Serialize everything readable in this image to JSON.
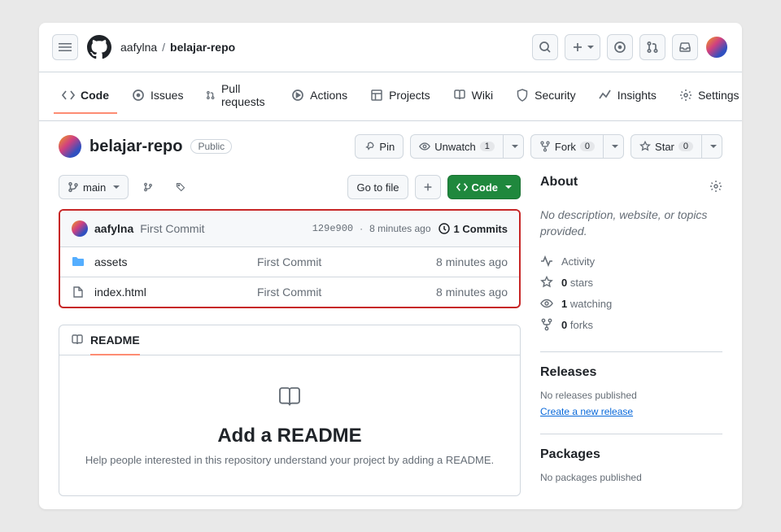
{
  "breadcrumb": {
    "owner": "aafylna",
    "repo": "belajar-repo",
    "sep": "/"
  },
  "nav": {
    "code": "Code",
    "issues": "Issues",
    "pulls": "Pull requests",
    "actions": "Actions",
    "projects": "Projects",
    "wiki": "Wiki",
    "security": "Security",
    "insights": "Insights",
    "settings": "Settings"
  },
  "repoHeader": {
    "title": "belajar-repo",
    "visibility": "Public",
    "pin": "Pin",
    "unwatch": "Unwatch",
    "unwatchCount": "1",
    "fork": "Fork",
    "forkCount": "0",
    "star": "Star",
    "starCount": "0"
  },
  "tools": {
    "branch": "main",
    "gotofile": "Go to file",
    "code": "Code"
  },
  "commit": {
    "author": "aafylna",
    "message": "First Commit",
    "sha": "129e900",
    "sep": "·",
    "time": "8 minutes ago",
    "countLabel": "1 Commits"
  },
  "files": [
    {
      "type": "folder",
      "name": "assets",
      "message": "First Commit",
      "time": "8 minutes ago"
    },
    {
      "type": "file",
      "name": "index.html",
      "message": "First Commit",
      "time": "8 minutes ago"
    }
  ],
  "readme": {
    "tab": "README",
    "title": "Add a README",
    "help": "Help people interested in this repository understand your project by adding a README."
  },
  "about": {
    "heading": "About",
    "desc": "No description, website, or topics provided.",
    "activity": "Activity",
    "starsNum": "0",
    "starsLbl": "stars",
    "watchNum": "1",
    "watchLbl": "watching",
    "forksNum": "0",
    "forksLbl": "forks"
  },
  "releases": {
    "heading": "Releases",
    "none": "No releases published",
    "link": "Create a new release"
  },
  "packages": {
    "heading": "Packages",
    "none": "No packages published"
  }
}
